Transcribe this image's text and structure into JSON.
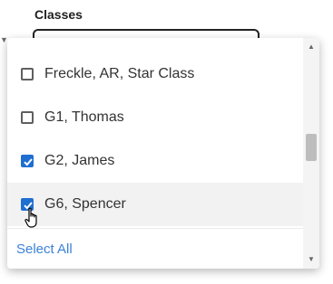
{
  "field": {
    "label": "Classes"
  },
  "dropdown": {
    "options": [
      {
        "label": "Freckle, AR, Star Class",
        "checked": false
      },
      {
        "label": "G1, Thomas",
        "checked": false
      },
      {
        "label": "G2, James",
        "checked": true
      },
      {
        "label": "G6, Spencer",
        "checked": true
      }
    ],
    "select_all_label": "Select All",
    "accent_color": "#1f6fd1",
    "link_color": "#3b82d6"
  }
}
